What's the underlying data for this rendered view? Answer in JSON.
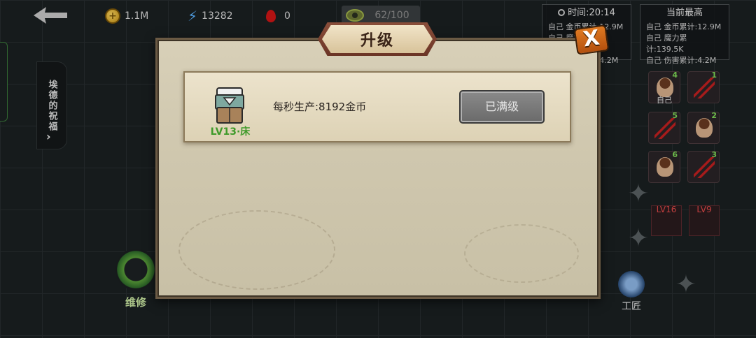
{
  "hud": {
    "gold": "1.1M",
    "energy": "13282",
    "blood": "0",
    "eye_progress": "62/100"
  },
  "time_box": {
    "label": "时间:",
    "value": "20:14",
    "rows": [
      "自己 金币累计:12.9M",
      "自己 魔力累计:139.5K",
      "自己 伤害累计:4.2M"
    ]
  },
  "record_box": {
    "title": "当前最高",
    "rows": [
      "自己 金币累计:12.9M",
      "自己 魔力累计:139.5K",
      "自己 伤害累计:4.2M"
    ]
  },
  "sidebar": {
    "blessing": "埃德的祝福"
  },
  "buttons": {
    "repair": "维修",
    "craft": "工匠"
  },
  "slots": [
    {
      "num": "4",
      "kind": "face",
      "tag": "自己"
    },
    {
      "num": "1",
      "kind": "claw",
      "tag": ""
    },
    {
      "num": "5",
      "kind": "claw",
      "tag": ""
    },
    {
      "num": "2",
      "kind": "face",
      "tag": ""
    },
    {
      "num": "6",
      "kind": "face",
      "tag": ""
    },
    {
      "num": "3",
      "kind": "claw",
      "tag": ""
    }
  ],
  "levels": [
    "LV16",
    "LV9"
  ],
  "dialog": {
    "title": "升级",
    "close": "X",
    "item": {
      "level": "LV13·床",
      "description": "每秒生产:8192金币",
      "action": "已满级"
    }
  },
  "colors": {
    "panel": "#d8d0b8",
    "banner": "#8a4e3a",
    "close_button": "#e07a22",
    "level_text": "#3f9a2a",
    "max_button": "#7a7a7a"
  }
}
